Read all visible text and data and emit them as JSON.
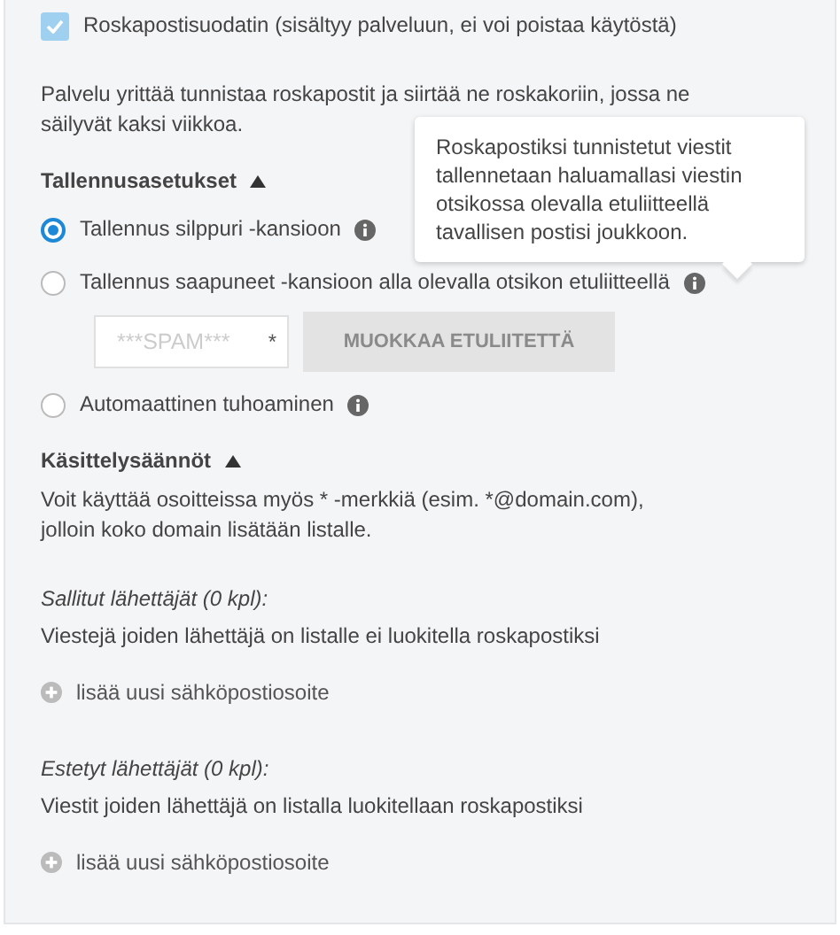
{
  "filter_checkbox": {
    "label": "Roskapostisuodatin (sisältyy palveluun, ei voi poistaa käytöstä)",
    "checked": true,
    "disabled": true
  },
  "description": "Palvelu yrittää tunnistaa roskapostit ja siirtää ne roskakoriin, jossa ne säilyvät kaksi viikkoa.",
  "storage": {
    "heading": "Tallennusasetukset",
    "expanded": true,
    "options": [
      {
        "label": "Tallennus silppuri -kansioon",
        "selected": true,
        "info": true
      },
      {
        "label": "Tallennus saapuneet -kansioon alla olevalla otsikon etuliitteellä",
        "selected": false,
        "info": true
      },
      {
        "label": "Automaattinen tuhoaminen",
        "selected": false,
        "info": true
      }
    ],
    "prefix_field": {
      "placeholder": "***SPAM***",
      "required_mark": "*"
    },
    "edit_button": {
      "label": "MUOKKAA ETULIITETTÄ",
      "disabled": true
    }
  },
  "tooltip": "Roskapostiksi tunnistetut viestit tallennetaan haluamallasi viestin otsikossa olevalla etuliitteellä tavallisen postisi joukkoon.",
  "rules": {
    "heading": "Käsittelysäännöt",
    "expanded": true,
    "description": "Voit käyttää osoitteissa myös * -merkkiä (esim. *@domain.com), jolloin koko domain lisätään listalle.",
    "lists": [
      {
        "title": "Sallitut lähettäjät (0 kpl):",
        "text": "Viestejä joiden lähettäjä on listalle ei luokitella roskapostiksi",
        "add_link": "lisää uusi sähköpostiosoite"
      },
      {
        "title": "Estetyt lähettäjät (0 kpl):",
        "text": "Viestit joiden lähettäjä on listalla luokitellaan roskapostiksi",
        "add_link": "lisää uusi sähköpostiosoite"
      }
    ]
  }
}
